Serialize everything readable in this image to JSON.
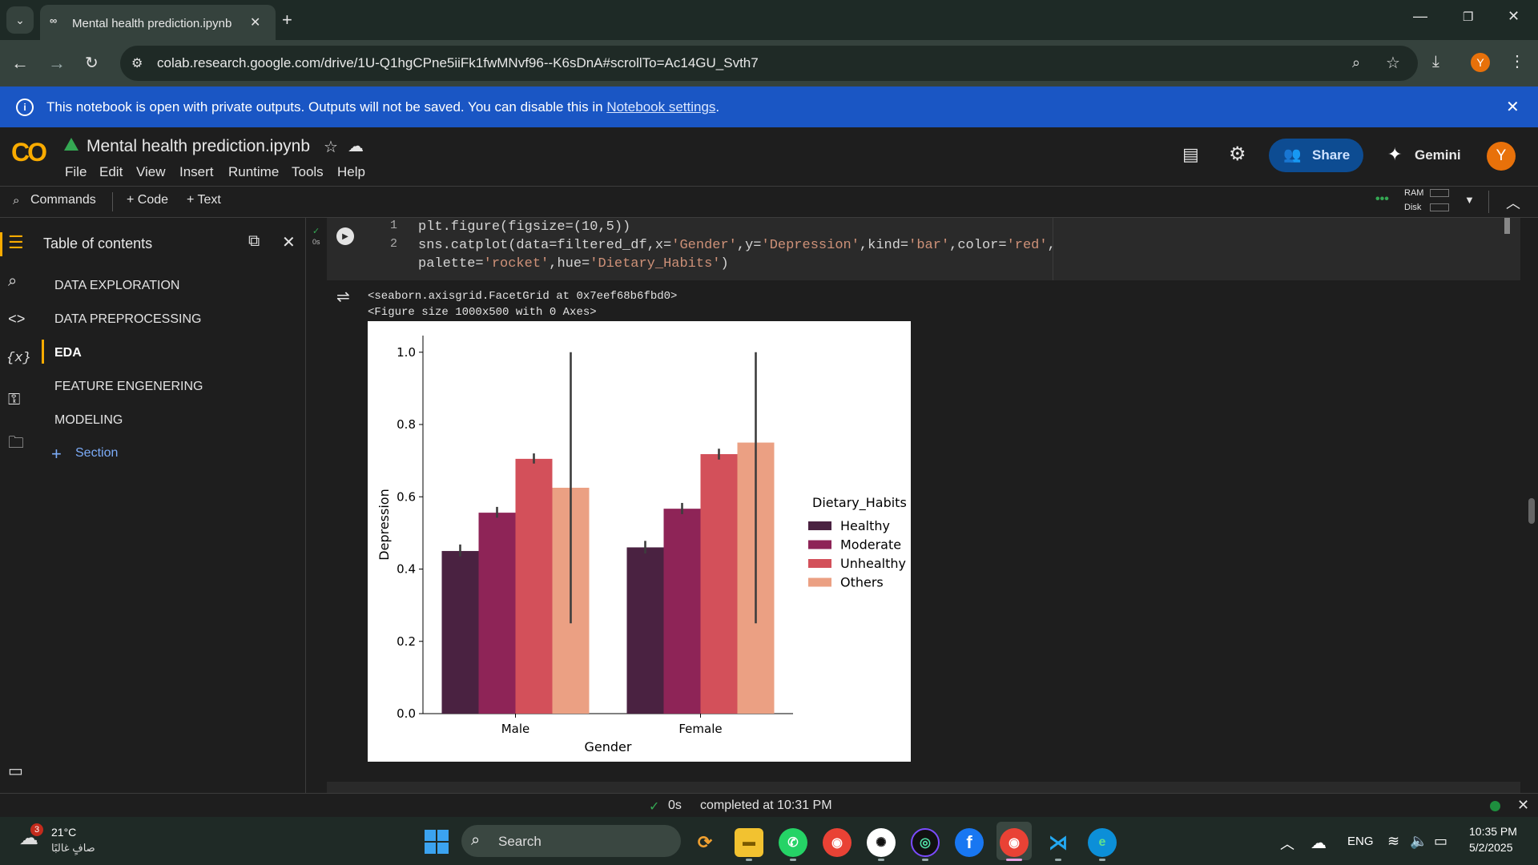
{
  "browser": {
    "tab_title": "Mental health prediction.ipynb",
    "url": "colab.research.google.com/drive/1U-Q1hgCPne5iiFk1fwMNvf96--K6sDnA#scrollTo=Ac14GU_Svth7",
    "profile_initial": "Y"
  },
  "banner": {
    "text": "This notebook is open with private outputs. Outputs will not be saved. You can disable this in",
    "link": "Notebook settings",
    "suffix": "."
  },
  "colab": {
    "logo": "CO",
    "notebook_title": "Mental health prediction.ipynb",
    "menu": [
      "File",
      "Edit",
      "View",
      "Insert",
      "Runtime",
      "Tools",
      "Help"
    ],
    "share_label": "Share",
    "gemini_label": "Gemini",
    "avatar_initial": "Y",
    "commands_label": "Commands",
    "add_code_label": "+ Code",
    "add_text_label": "+ Text",
    "ram_label": "RAM",
    "disk_label": "Disk"
  },
  "toc": {
    "title": "Table of contents",
    "items": [
      {
        "label": "DATA EXPLORATION",
        "active": false
      },
      {
        "label": "DATA PREPROCESSING",
        "active": false
      },
      {
        "label": "EDA",
        "active": true
      },
      {
        "label": "FEATURE ENGENERING",
        "active": false
      },
      {
        "label": "MODELING",
        "active": false
      }
    ],
    "section_label": "Section"
  },
  "cell": {
    "exec_time": "0s",
    "line_numbers": [
      "1",
      "2"
    ],
    "output_text": [
      "<seaborn.axisgrid.FacetGrid at 0x7eef68b6fbd0>",
      "<Figure size 1000x500 with 0 Axes>"
    ]
  },
  "chart_data": {
    "type": "bar",
    "categories": [
      "Male",
      "Female"
    ],
    "xlabel": "Gender",
    "ylabel": "Depression",
    "ylim": [
      0,
      1.0
    ],
    "yticks": [
      "0.0",
      "0.2",
      "0.4",
      "0.6",
      "0.8",
      "1.0"
    ],
    "legend_title": "Dietary_Habits",
    "legend_placement": "right",
    "series": [
      {
        "name": "Healthy",
        "color": "#4a2241",
        "values": [
          0.45,
          0.46
        ],
        "ci": [
          [
            0.435,
            0.468
          ],
          [
            0.443,
            0.478
          ]
        ]
      },
      {
        "name": "Moderate",
        "color": "#8e2457",
        "values": [
          0.556,
          0.567
        ],
        "ci": [
          [
            0.542,
            0.572
          ],
          [
            0.552,
            0.583
          ]
        ]
      },
      {
        "name": "Unhealthy",
        "color": "#d3505a",
        "values": [
          0.705,
          0.718
        ],
        "ci": [
          [
            0.692,
            0.72
          ],
          [
            0.703,
            0.733
          ]
        ]
      },
      {
        "name": "Others",
        "color": "#eba083",
        "values": [
          0.625,
          0.75
        ],
        "ci": [
          [
            0.25,
            1.0
          ],
          [
            0.25,
            1.0
          ]
        ]
      }
    ]
  },
  "status": {
    "check": "✓",
    "time": "0s",
    "text": "completed at 10:31 PM"
  },
  "taskbar": {
    "weather_temp": "21°C",
    "weather_desc": "صافٍ غالبًا",
    "weather_badge": "3",
    "search_label": "Search",
    "lang": "ENG",
    "time": "10:35 PM",
    "date": "5/2/2025"
  }
}
